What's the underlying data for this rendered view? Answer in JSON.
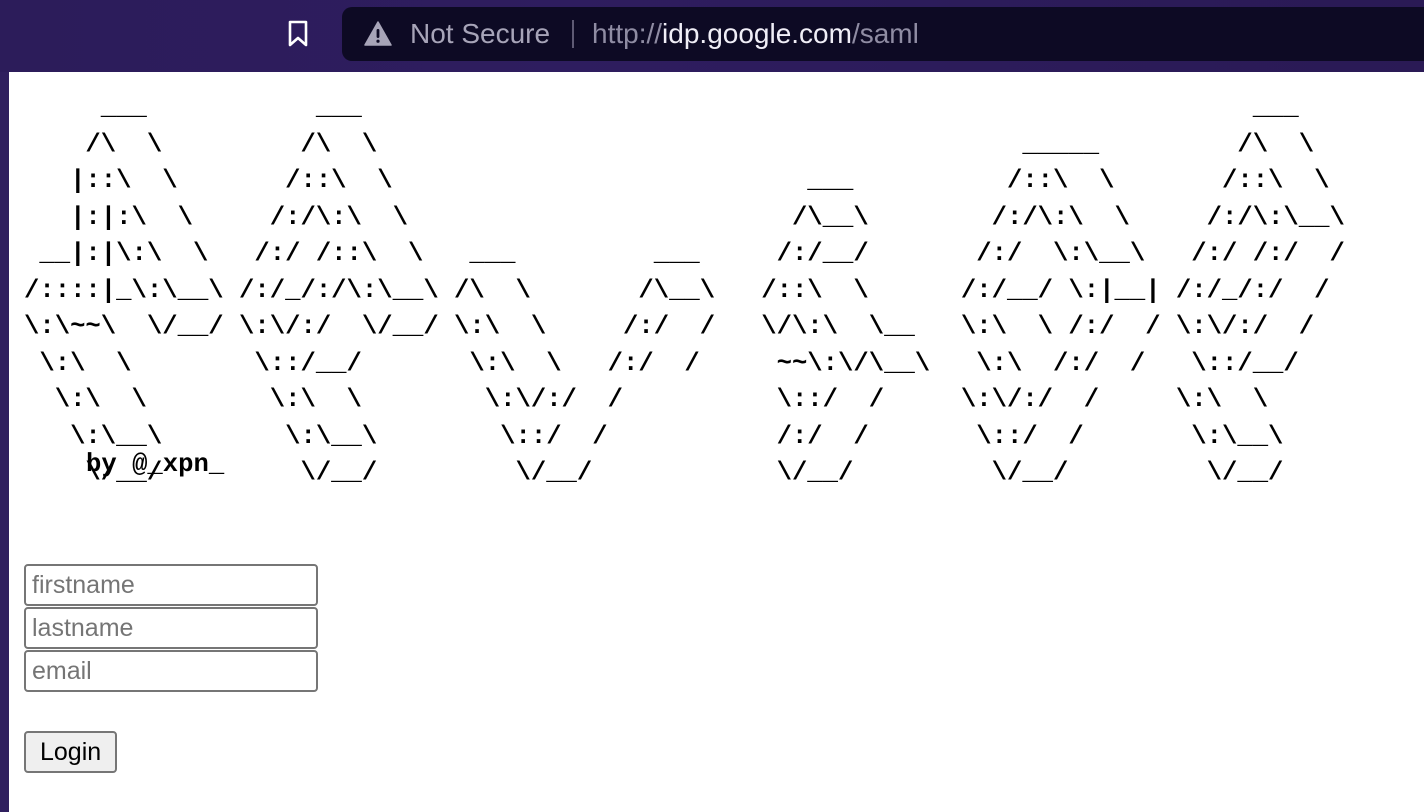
{
  "browser": {
    "security_label": "Not Secure",
    "url_scheme": "http://",
    "url_host": "idp.google.com",
    "url_path": "/saml"
  },
  "page": {
    "ascii_banner": "     ___           ___                                                          ___     \n    /\\  \\         /\\  \\                                          _____         /\\  \\    \n   |::\\  \\       /::\\  \\                           ___          /::\\  \\       /::\\  \\   \n   |:|:\\  \\     /:/\\:\\  \\                         /\\__\\        /:/\\:\\  \\     /:/\\:\\__\\  \n __|:|\\:\\  \\   /:/ /::\\  \\   ___         ___     /:/__/       /:/  \\:\\__\\   /:/ /:/  /  \n/::::|_\\:\\__\\ /:/_/:/\\:\\__\\ /\\  \\       /\\__\\   /::\\  \\      /:/__/ \\:|__| /:/_/:/  /   \n\\:\\~~\\  \\/__/ \\:\\/:/  \\/__/ \\:\\  \\     /:/  /   \\/\\:\\  \\__   \\:\\  \\ /:/  / \\:\\/:/  /    \n \\:\\  \\        \\::/__/       \\:\\  \\   /:/  /     ~~\\:\\/\\__\\   \\:\\  /:/  /   \\::/__/     \n  \\:\\  \\        \\:\\  \\        \\:\\/:/  /          \\::/  /     \\:\\/:/  /     \\:\\  \\     \n   \\:\\__\\        \\:\\__\\        \\::/  /           /:/  /       \\::/  /       \\:\\__\\    \n    \\/__/         \\/__/         \\/__/            \\/__/         \\/__/         \\/__/    ",
    "byline": "by @_xpn_",
    "form": {
      "firstname_placeholder": "firstname",
      "lastname_placeholder": "lastname",
      "email_placeholder": "email",
      "login_label": "Login"
    }
  }
}
